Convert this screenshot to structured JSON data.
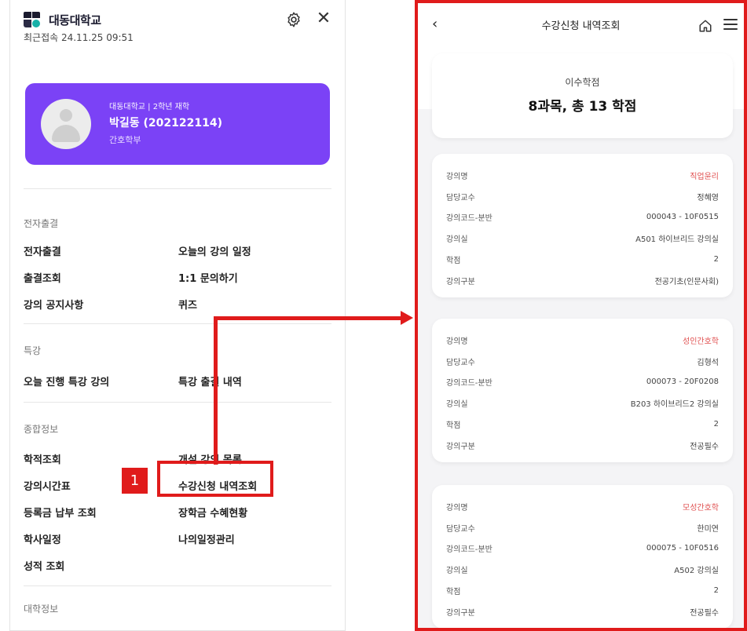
{
  "left": {
    "brand": "대동대학교",
    "last_login": "최근접속 24.11.25 09:51",
    "profile": {
      "school_year": "대동대학교 | 2학년 재학",
      "name": "박길동 (202122114)",
      "dept": "간호학부"
    },
    "sections": [
      {
        "title": "전자출결",
        "items": [
          "전자출결",
          "오늘의 강의 일정",
          "출결조회",
          "1:1 문의하기",
          "강의 공지사항",
          "퀴즈"
        ]
      },
      {
        "title": "특강",
        "items": [
          "오늘 진행 특강 강의",
          "특강 출결 내역"
        ]
      },
      {
        "title": "종합정보",
        "items": [
          "학적조회",
          "개설 강의 목록",
          "강의시간표",
          "수강신청 내역조회",
          "등록금 납부 조회",
          "장학금 수혜현황",
          "학사일정",
          "나의일정관리",
          "성적 조회"
        ]
      },
      {
        "title": "대학정보",
        "items": []
      }
    ],
    "callout_number": "1"
  },
  "right": {
    "title": "수강신청 내역조회",
    "summary_label": "이수학점",
    "summary_value": "8과목, 총 13 학점",
    "field_labels": [
      "강의명",
      "담당교수",
      "강의코드-분반",
      "강의실",
      "학점",
      "강의구분"
    ],
    "courses": [
      {
        "name": "직업윤리",
        "professor": "정혜영",
        "code": "000043 - 10F0515",
        "room": "A501 하이브리드 강의실",
        "credit": "2",
        "type": "전공기초(인문사회)"
      },
      {
        "name": "성인간호학",
        "professor": "김형석",
        "code": "000073 - 20F0208",
        "room": "B203 하이브리드2 강의실",
        "credit": "2",
        "type": "전공필수"
      },
      {
        "name": "모성간호학",
        "professor": "한미연",
        "code": "000075 - 10F0516",
        "room": "A502 강의실",
        "credit": "2",
        "type": "전공필수"
      }
    ]
  },
  "colors": {
    "accent_purple": "#7b42f6",
    "highlight_red": "#e01b1b",
    "course_name_red": "#e05050"
  },
  "icons": [
    "gear-icon",
    "close-icon",
    "back-chevron-icon",
    "home-icon",
    "menu-icon",
    "avatar-placeholder-icon"
  ]
}
